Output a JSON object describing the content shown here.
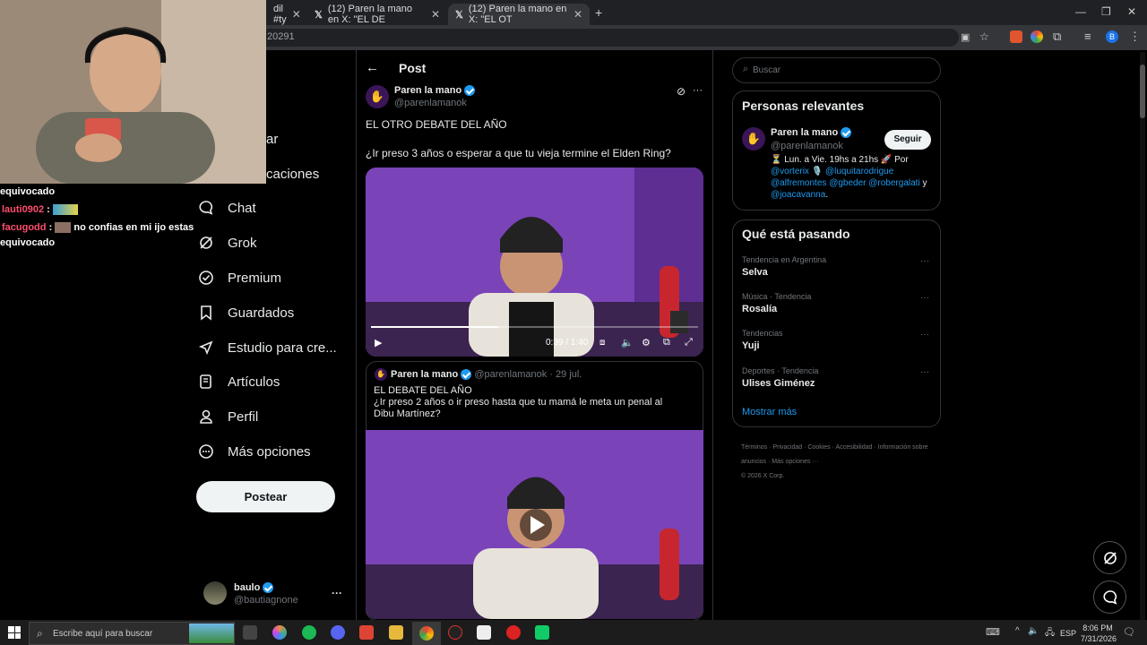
{
  "browser": {
    "tabs": [
      {
        "label": "dil #ty"
      },
      {
        "label": "(12) Paren la mano en X: \"EL DE"
      },
      {
        "label": "(12) Paren la mano en X: \"EL OT"
      }
    ],
    "url_fragment": "20291",
    "window_min": "—",
    "window_restore": "❐",
    "window_close": "✕",
    "new_tab": "+"
  },
  "stream_chat": {
    "line1": "equivocado",
    "line2_user": "lauti0902",
    "line2_sep": ":",
    "line3_user": "facugodd",
    "line3_sep": ":",
    "line3_msg": "no confias en mi ijo estas",
    "line4": "equivocado"
  },
  "nav": {
    "partial1": "ar",
    "partial2": "caciones",
    "items": [
      {
        "label": "Chat",
        "icon": "chat-icon"
      },
      {
        "label": "Grok",
        "icon": "grok-icon"
      },
      {
        "label": "Premium",
        "icon": "premium-icon"
      },
      {
        "label": "Guardados",
        "icon": "bookmark-icon"
      },
      {
        "label": "Estudio para cre...",
        "icon": "rocket-icon"
      },
      {
        "label": "Artículos",
        "icon": "article-icon"
      },
      {
        "label": "Perfil",
        "icon": "profile-icon"
      },
      {
        "label": "Más opciones",
        "icon": "more-circle-icon"
      }
    ],
    "post_button": "Postear",
    "account_name": "baulo",
    "account_handle": "@bautiagnone",
    "account_more": "···"
  },
  "post": {
    "header_title": "Post",
    "author_name": "Paren la mano",
    "author_handle": "@parenlamanok",
    "line1": "EL OTRO DEBATE DEL AÑO",
    "line2": "¿Ir preso 3 años o esperar a que tu vieja termine el Elden Ring?",
    "video_time": "0:39 / 1:40",
    "video_progress": 0.39,
    "more": "···"
  },
  "quoted": {
    "author_name": "Paren la mano",
    "author_handle": "@parenlamanok",
    "date": "· 29 jul.",
    "line1": "EL DEBATE DEL AÑO",
    "line2": "¿Ir preso 2 años o ir preso hasta que tu mamá le meta un penal al Dibu Martínez?"
  },
  "right": {
    "search_placeholder": "Buscar",
    "relevant_title": "Personas relevantes",
    "relevant_name": "Paren la mano",
    "relevant_handle": "@parenlamanok",
    "follow_button": "Seguir",
    "bio_text": "⏳ Lun. a Vie. 19hs a 21hs 🚀 Por",
    "bio_mention1": "@vorterix",
    "bio_mention2": "🎙️ @luquitarodrigue",
    "bio_mention3": "@alfremontes",
    "bio_mention4": "@gbeder",
    "bio_mention5": "@robergalati",
    "bio_y": "y",
    "bio_mention6": "@joacavanna",
    "bio_end": ".",
    "trending_title": "Qué está pasando",
    "trends": [
      {
        "category": "Tendencia en Argentina",
        "name": "Selva"
      },
      {
        "category": "Música · Tendencia",
        "name": "Rosalía"
      },
      {
        "category": "Tendencias",
        "name": "Yuji"
      },
      {
        "category": "Deportes · Tendencia",
        "name": "Ulises Giménez"
      }
    ],
    "trend_more": "···",
    "show_more": "Mostrar más",
    "footer": [
      "Términos",
      "·",
      "Privacidad",
      "·",
      "Cookies",
      "·",
      "Accesibilidad",
      "·",
      "Información sobre anuncios",
      "·",
      "Más opciones ···",
      "© 2026 X Corp."
    ]
  },
  "taskbar": {
    "search_placeholder": "Escribe aquí para buscar",
    "lang": "ESP",
    "time": "8:06 PM",
    "date": "7/31/2026"
  },
  "colors": {
    "accent": "#1d9bf0",
    "chat_user": "#ff4d6d",
    "bg": "#000000"
  }
}
